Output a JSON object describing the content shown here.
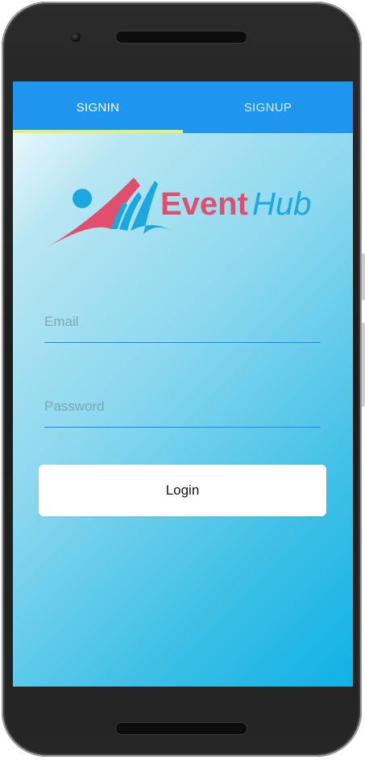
{
  "tabs": {
    "signin_label": "SIGNIN",
    "signup_label": "SIGNUP",
    "active": "SIGNIN"
  },
  "logo": {
    "text_event": "Event",
    "text_hub": "Hub",
    "colors": {
      "event": "#e24e6d",
      "hub": "#1ba8e0",
      "wing": "#e24e6d",
      "arcs": "#1ba8e0"
    }
  },
  "form": {
    "email_placeholder": "Email",
    "email_value": "",
    "password_placeholder": "Password",
    "password_value": ""
  },
  "actions": {
    "login_label": "Login"
  },
  "colors": {
    "tabbar": "#1e96f0",
    "tab_indicator": "#e8f06a",
    "field_underline": "#1e88e5"
  }
}
